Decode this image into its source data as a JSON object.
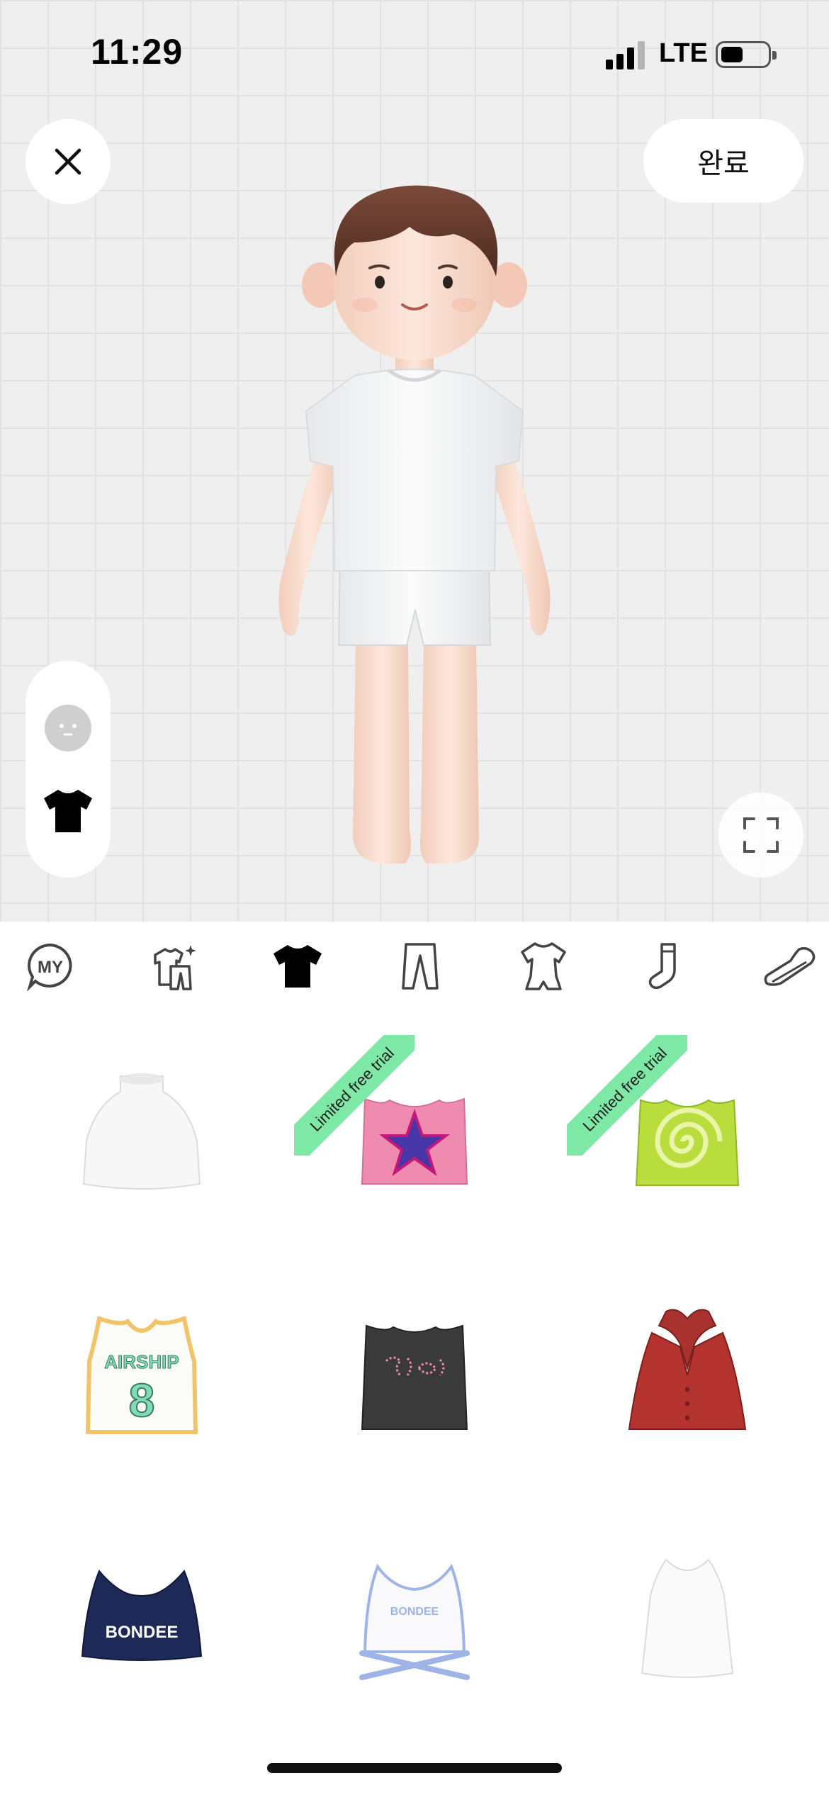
{
  "status_bar": {
    "time": "11:29",
    "network": "LTE"
  },
  "header": {
    "done_label": "완료"
  },
  "categories": [
    {
      "name": "my",
      "label": "MY",
      "active": false
    },
    {
      "name": "outfit-sets",
      "active": false
    },
    {
      "name": "tops",
      "active": true
    },
    {
      "name": "bottoms",
      "active": false
    },
    {
      "name": "onepiece",
      "active": false
    },
    {
      "name": "socks",
      "active": false
    },
    {
      "name": "shoes",
      "active": false
    }
  ],
  "items": [
    {
      "name": "white-halter-crop-top",
      "badge": ""
    },
    {
      "name": "pink-star-tank-top",
      "badge": "Limited free trial"
    },
    {
      "name": "green-tie-dye-crop-top",
      "badge": "Limited free trial"
    },
    {
      "name": "airship-basketball-jersey",
      "badge": "",
      "print_text": "AIRSHIP",
      "number": "8"
    },
    {
      "name": "black-graphic-tank",
      "badge": ""
    },
    {
      "name": "red-halter-vest",
      "badge": ""
    },
    {
      "name": "navy-bondee-sports-bra",
      "badge": "",
      "print_text": "BONDEE"
    },
    {
      "name": "white-bondee-cross-crop-top",
      "badge": "",
      "print_text": "BONDEE"
    },
    {
      "name": "white-tank-top",
      "badge": ""
    }
  ],
  "colors": {
    "badge": "#7ee8a6",
    "background": "#efefef",
    "accent": "#000000"
  }
}
